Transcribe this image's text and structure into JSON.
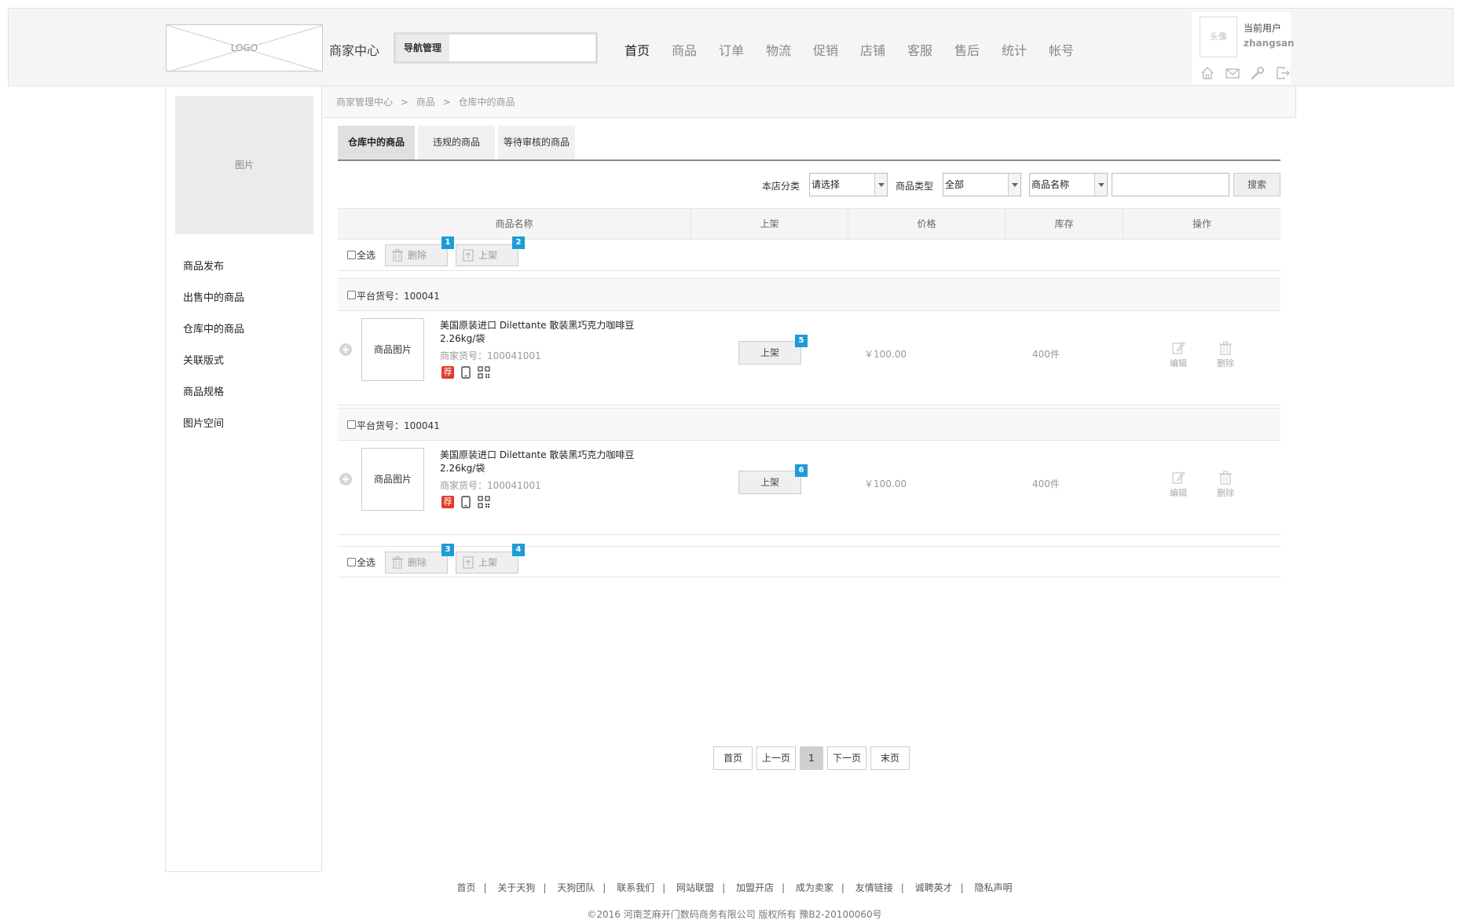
{
  "header": {
    "logo_text": "LOGO",
    "title": "商家中心",
    "nav_search_label": "导航管理",
    "nav_search_value": "",
    "nav": [
      "首页",
      "商品",
      "订单",
      "物流",
      "促销",
      "店铺",
      "客服",
      "售后",
      "统计",
      "帐号"
    ],
    "user": {
      "avatar_text": "头像",
      "label": "当前用户",
      "name": "zhangsan"
    },
    "user_icons": [
      "home-icon",
      "mail-icon",
      "wrench-icon",
      "logout-icon"
    ]
  },
  "sidebar": {
    "image_text": "图片",
    "items": [
      "商品发布",
      "出售中的商品",
      "仓库中的商品",
      "关联版式",
      "商品规格",
      "图片空间"
    ]
  },
  "breadcrumb": [
    "商家管理中心",
    "商品",
    "仓库中的商品"
  ],
  "breadcrumb_sep": ">",
  "tabs": [
    "仓库中的商品",
    "违规的商品",
    "等待审核的商品"
  ],
  "filter": {
    "category_label": "本店分类",
    "category_value": "请选择",
    "type_label": "商品类型",
    "type_value": "全部",
    "field_value": "商品名称",
    "keyword": "",
    "search_button": "搜索"
  },
  "table_headers": [
    "商品名称",
    "上架",
    "价格",
    "库存",
    "操作"
  ],
  "batch_top": {
    "select_all": "全选",
    "delete": "删除",
    "shelve": "上架",
    "badges": [
      "1",
      "2"
    ]
  },
  "batch_bottom": {
    "select_all": "全选",
    "delete": "删除",
    "shelve": "上架",
    "badges": [
      "3",
      "4"
    ]
  },
  "products": [
    {
      "sku_label": "平台货号：100041",
      "image_text": "商品图片",
      "name": "美国原装进口 Dilettante 散装黑巧克力咖啡豆 2.26kg/袋",
      "merchant_code": "商家货号：100041001",
      "tag": "荐",
      "shelve_button": "上架",
      "badge": "5",
      "price": "￥100.00",
      "stock": "400件",
      "edit": "编辑",
      "delete": "删除"
    },
    {
      "sku_label": "平台货号：100041",
      "image_text": "商品图片",
      "name": "美国原装进口 Dilettante 散装黑巧克力咖啡豆 2.26kg/袋",
      "merchant_code": "商家货号：100041001",
      "tag": "荐",
      "shelve_button": "上架",
      "badge": "6",
      "price": "￥100.00",
      "stock": "400件",
      "edit": "编辑",
      "delete": "删除"
    }
  ],
  "pagination": {
    "first": "首页",
    "prev": "上一页",
    "current": "1",
    "next": "下一页",
    "last": "末页"
  },
  "footer": {
    "links": [
      "首页",
      "关于天狗",
      "天狗团队",
      "联系我们",
      "网站联盟",
      "加盟开店",
      "成为卖家",
      "友情链接",
      "诚聘英才",
      "隐私声明"
    ],
    "separator": "|",
    "copyright": "©2016 河南芝麻开门数码商务有限公司 版权所有 豫B2-20100060号"
  },
  "colors": {
    "badge": "#1e9bd7",
    "tag_recommend": "#e23b2e"
  }
}
